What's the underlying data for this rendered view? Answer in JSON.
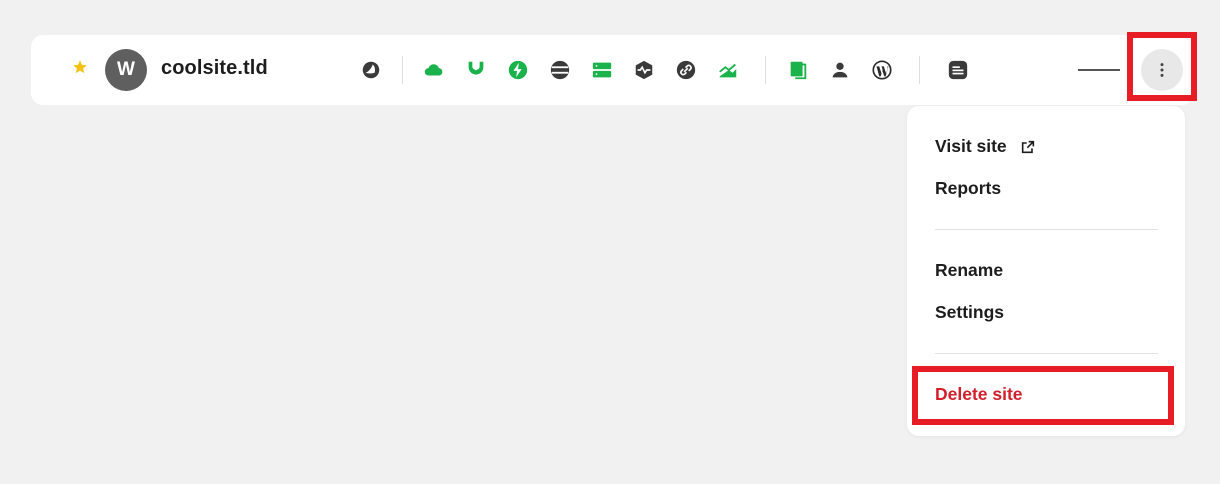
{
  "site": {
    "favorite_icon": "star-icon",
    "avatar_letter": "W",
    "name": "coolsite.tld"
  },
  "toolbar_icons": [
    "cloudflare-icon",
    "cdn-cloud-icon",
    "security-shield-icon",
    "performance-bolt-icon",
    "database-icon",
    "server-icon",
    "uptime-monitor-icon",
    "links-icon",
    "analytics-chart-icon",
    "backups-pages-icon",
    "users-icon",
    "wordpress-icon",
    "notes-icon"
  ],
  "more_button_icon": "more-vertical-icon",
  "menu": {
    "visit_site": "Visit site",
    "reports": "Reports",
    "rename": "Rename",
    "settings": "Settings",
    "delete_site": "Delete site"
  },
  "colors": {
    "accent_green": "#1ab24b",
    "icon_dark": "#3a3a3a",
    "danger": "#d21f2b",
    "highlight": "#e81c24",
    "star": "#f4c20d"
  }
}
